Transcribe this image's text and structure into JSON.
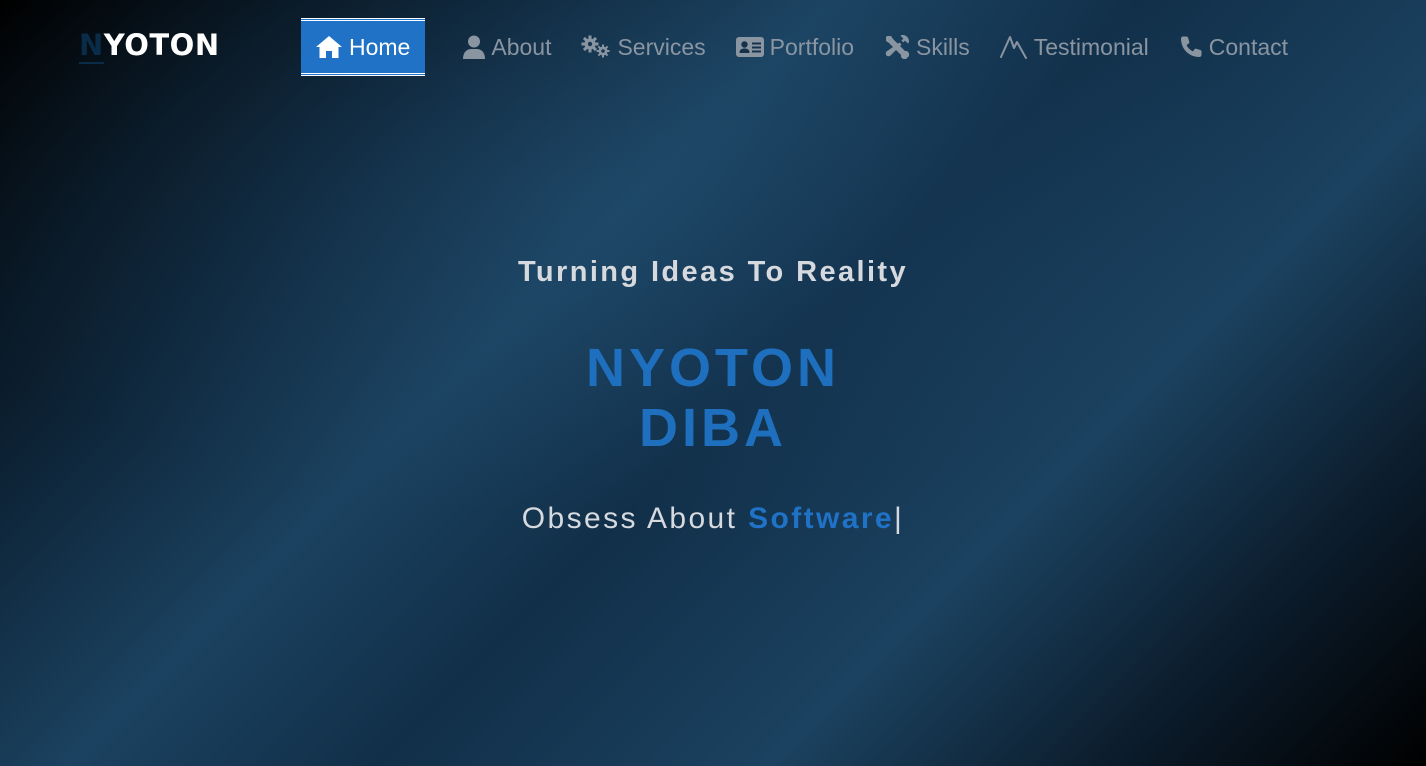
{
  "logo": {
    "first_letter": "N",
    "rest": "YOTON"
  },
  "nav": {
    "items": [
      {
        "label": "Home",
        "icon": "home-icon",
        "active": true
      },
      {
        "label": "About",
        "icon": "user-icon",
        "active": false
      },
      {
        "label": "Services",
        "icon": "gears-icon",
        "active": false
      },
      {
        "label": "Portfolio",
        "icon": "id-card-icon",
        "active": false
      },
      {
        "label": "Skills",
        "icon": "tools-icon",
        "active": false
      },
      {
        "label": "Testimonial",
        "icon": "signature-icon",
        "active": false
      },
      {
        "label": "Contact",
        "icon": "phone-icon",
        "active": false
      }
    ]
  },
  "hero": {
    "tagline": "Turning Ideas To Reality",
    "name_line1": "NYOTON",
    "name_line2": "DIBA",
    "subline_prefix": "Obsess About ",
    "subline_highlight": "Software",
    "cursor": "|"
  },
  "colors": {
    "accent": "#1f72c6",
    "nav_text": "#8a95a2",
    "hero_text": "#d6d9dd"
  }
}
